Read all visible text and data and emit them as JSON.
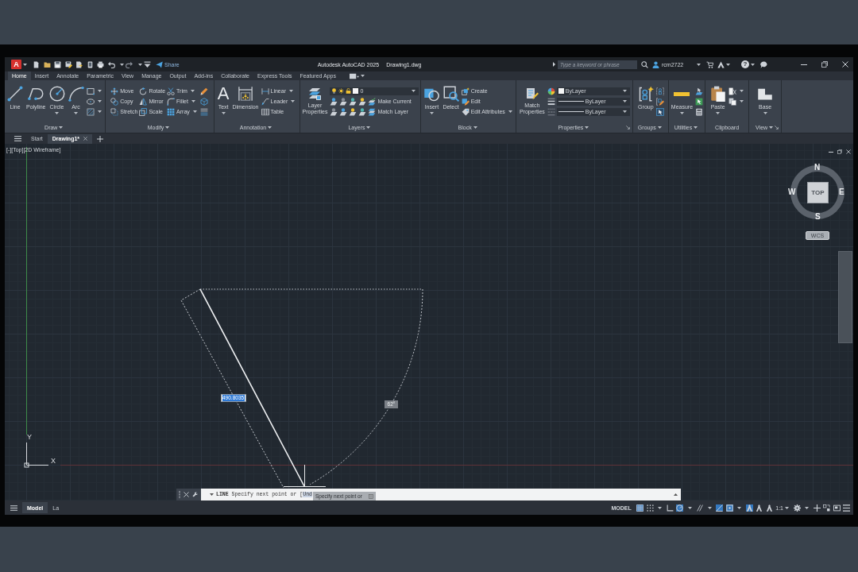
{
  "window": {
    "app_glyph": "A",
    "share": "Share",
    "title": "Autodesk AutoCAD 2025",
    "document": "Drawing1.dwg",
    "search": {
      "placeholder": "Type a keyword or phrase"
    },
    "user": "rcm2722",
    "help_glyph": "?"
  },
  "ribbon": {
    "tabs": [
      {
        "label": "Home",
        "selected": true
      },
      {
        "label": "Insert",
        "selected": false
      },
      {
        "label": "Annotate",
        "selected": false
      },
      {
        "label": "Parametric",
        "selected": false
      },
      {
        "label": "View",
        "selected": false
      },
      {
        "label": "Manage",
        "selected": false
      },
      {
        "label": "Output",
        "selected": false
      },
      {
        "label": "Add-ins",
        "selected": false
      },
      {
        "label": "Collaborate",
        "selected": false
      },
      {
        "label": "Express Tools",
        "selected": false
      },
      {
        "label": "Featured Apps",
        "selected": false
      }
    ],
    "panels": [
      {
        "title": "Draw",
        "menu": true,
        "launcher": false,
        "items": [
          {
            "kind": "large",
            "label": "Line",
            "menu": false
          },
          {
            "kind": "large",
            "label": "Polyline",
            "menu": false
          },
          {
            "kind": "large",
            "label": "Circle",
            "menu": true
          },
          {
            "kind": "large",
            "label": "Arc",
            "menu": true
          },
          {
            "kind": "column",
            "buttons": [
              {
                "kind": "icon",
                "menu": true
              },
              {
                "kind": "icon",
                "menu": true
              },
              {
                "kind": "icon",
                "menu": true
              }
            ]
          }
        ]
      },
      {
        "title": "Modify",
        "menu": true,
        "launcher": false,
        "items": [
          {
            "kind": "column",
            "buttons": [
              {
                "kind": "button",
                "label": "Move",
                "menu": false
              },
              {
                "kind": "button",
                "label": "Copy",
                "menu": false
              },
              {
                "kind": "button",
                "label": "Stretch",
                "menu": false
              }
            ]
          },
          {
            "kind": "column",
            "buttons": [
              {
                "kind": "button",
                "label": "Rotate",
                "menu": false
              },
              {
                "kind": "button",
                "label": "Mirror",
                "menu": false
              },
              {
                "kind": "button",
                "label": "Scale",
                "menu": false
              }
            ]
          },
          {
            "kind": "column",
            "buttons": [
              {
                "kind": "button",
                "label": "Trim",
                "menu": true
              },
              {
                "kind": "button",
                "label": "Fillet",
                "menu": true
              },
              {
                "kind": "button",
                "label": "Array",
                "menu": true
              }
            ]
          },
          {
            "kind": "column",
            "buttons": [
              {
                "kind": "icon",
                "menu": false
              },
              {
                "kind": "icon",
                "menu": false
              },
              {
                "kind": "icon",
                "menu": false
              }
            ]
          }
        ]
      },
      {
        "title": "Annotation",
        "menu": true,
        "launcher": false,
        "items": [
          {
            "kind": "large",
            "label": "Text",
            "glyph": "A",
            "menu": true
          },
          {
            "kind": "large",
            "label": "Dimension",
            "menu": false
          },
          {
            "kind": "column",
            "buttons": [
              {
                "kind": "button",
                "label": "Linear",
                "menu": true
              },
              {
                "kind": "button",
                "label": "Leader",
                "menu": true
              },
              {
                "kind": "button",
                "label": "Table",
                "menu": false
              }
            ]
          }
        ]
      },
      {
        "title": "Layers",
        "menu": true,
        "launcher": false,
        "items": [
          {
            "kind": "large",
            "label": "Layer Properties",
            "menu": false
          },
          {
            "kind": "column",
            "buttons": [
              {
                "kind": "dropdown",
                "value": "0",
                "menu": true
              },
              {
                "kind": "button",
                "label": "Make Current",
                "menu": false
              },
              {
                "kind": "button",
                "label": "Match Layer",
                "menu": false
              }
            ]
          }
        ]
      },
      {
        "title": "Block",
        "menu": true,
        "launcher": false,
        "items": [
          {
            "kind": "large",
            "label": "Insert",
            "menu": true
          },
          {
            "kind": "large",
            "label": "Detect",
            "menu": false
          },
          {
            "kind": "column",
            "buttons": [
              {
                "kind": "button",
                "label": "Create",
                "menu": false
              },
              {
                "kind": "button",
                "label": "Edit",
                "menu": false
              },
              {
                "kind": "button",
                "label": "Edit Attributes",
                "menu": true
              }
            ]
          }
        ]
      },
      {
        "title": "Properties",
        "menu": true,
        "launcher": true,
        "items": [
          {
            "kind": "large",
            "label": "Match Properties",
            "menu": false
          },
          {
            "kind": "column",
            "buttons": [
              {
                "kind": "dropdown",
                "value": "ByLayer",
                "menu": true
              },
              {
                "kind": "dropdown",
                "value": "ByLayer",
                "menu": true
              },
              {
                "kind": "dropdown",
                "value": "ByLayer",
                "menu": true
              }
            ]
          }
        ]
      },
      {
        "title": "Groups",
        "menu": true,
        "launcher": false,
        "items": [
          {
            "kind": "large",
            "label": "Group",
            "menu": false
          },
          {
            "kind": "column",
            "buttons": [
              {
                "kind": "icon",
                "menu": false
              },
              {
                "kind": "icon",
                "menu": false
              },
              {
                "kind": "icon",
                "menu": false
              }
            ]
          }
        ]
      },
      {
        "title": "Utilities",
        "menu": true,
        "launcher": false,
        "items": [
          {
            "kind": "large",
            "label": "Measure",
            "menu": true
          },
          {
            "kind": "column",
            "buttons": [
              {
                "kind": "icon",
                "menu": false
              },
              {
                "kind": "icon",
                "menu": false
              },
              {
                "kind": "icon",
                "menu": false
              }
            ]
          }
        ]
      },
      {
        "title": "Clipboard",
        "menu": false,
        "launcher": false,
        "items": [
          {
            "kind": "large",
            "label": "Paste",
            "menu": true
          },
          {
            "kind": "column",
            "buttons": [
              {
                "kind": "icon",
                "menu": true
              },
              {
                "kind": "icon",
                "menu": true
              }
            ]
          }
        ]
      },
      {
        "title": "View",
        "menu": true,
        "launcher": true,
        "items": [
          {
            "kind": "large",
            "label": "Base",
            "menu": true
          }
        ]
      }
    ]
  },
  "file_tabs": [
    {
      "label": "Start",
      "selected": false,
      "closable": false
    },
    {
      "label": "Drawing1*",
      "selected": true,
      "closable": true
    }
  ],
  "viewport": {
    "label": "[-][Top][2D Wireframe]"
  },
  "viewcube": {
    "face": "TOP",
    "north": "N",
    "south": "S",
    "east": "E",
    "west": "W",
    "coordinate_system": "WCS"
  },
  "ucs": {
    "y_label": "Y",
    "x_label": "X"
  },
  "dynamic_input": {
    "distance": "490.8035",
    "angle": "62°"
  },
  "command_line": {
    "prompt": "**LINE** Specify next point or [",
    "option": "Und",
    "tooltip": "Specify next point or"
  },
  "status_bar": {
    "layout_tabs": [
      {
        "label": "Model",
        "selected": true
      },
      {
        "label": "La",
        "selected": false
      }
    ],
    "space": "MODEL",
    "toggles": [
      {
        "on": true
      },
      {
        "on": false
      },
      {
        "on": false
      },
      {
        "on": true
      },
      {
        "on": false
      },
      {
        "on": true
      },
      {
        "on": true
      },
      {
        "on": true
      },
      {
        "on": false
      },
      {
        "on": false
      }
    ],
    "scale": "1:1"
  }
}
